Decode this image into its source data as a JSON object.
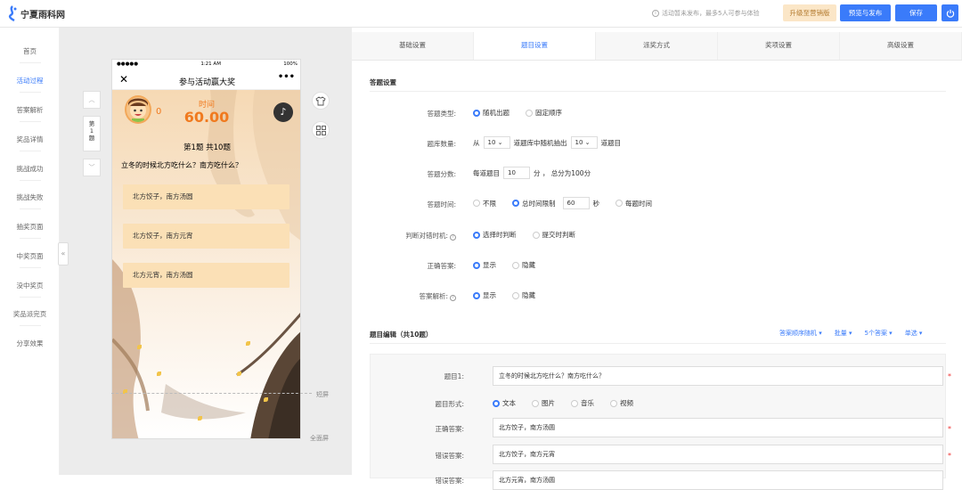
{
  "header": {
    "logo_text": "宁夏雨科网",
    "notice": "活动暂未发布，最多5人可参与体验",
    "upgrade_label": "升级至营销版",
    "preview_label": "预览与发布",
    "save_label": "保存"
  },
  "sidebar": {
    "items": [
      {
        "label": "首页",
        "active": false
      },
      {
        "label": "活动过程",
        "active": true
      },
      {
        "label": "答案解析",
        "active": false
      },
      {
        "label": "奖品详情",
        "active": false
      },
      {
        "label": "挑战成功",
        "active": false
      },
      {
        "label": "挑战失败",
        "active": false
      },
      {
        "label": "抽奖页面",
        "active": false
      },
      {
        "label": "中奖页面",
        "active": false
      },
      {
        "label": "没中奖页",
        "active": false
      },
      {
        "label": "奖品派完页",
        "active": false
      },
      {
        "label": "分享效果",
        "active": false
      }
    ],
    "collapse_glyph": "«"
  },
  "pagenav": {
    "up_glyph": "︿",
    "current": [
      "第",
      "1",
      "题"
    ],
    "down_glyph": "﹀"
  },
  "phone": {
    "status_left": "●●●●●",
    "status_time": "1:21 AM",
    "status_right": "100%",
    "close_glyph": "✕",
    "title": "参与活动赢大奖",
    "more_glyph": "•••",
    "score": "0",
    "timer_label": "时间",
    "timer_value": "60.00",
    "music_glyph": "♪",
    "question_number": "第1题 共10题",
    "question_text": "立冬的时候北方吃什么？南方吃什么？",
    "options": [
      "北方饺子，南方汤圆",
      "北方饺子，南方元宵",
      "北方元宵，南方汤圆"
    ]
  },
  "canvas": {
    "short_screen_label": "短屏",
    "full_screen_label": "全面屏",
    "tool_icons": [
      "shirt-icon",
      "qrcode-icon"
    ]
  },
  "tabs": [
    {
      "label": "基础设置",
      "active": false
    },
    {
      "label": "题目设置",
      "active": true
    },
    {
      "label": "派奖方式",
      "active": false
    },
    {
      "label": "奖项设置",
      "active": false
    },
    {
      "label": "高级设置",
      "active": false
    }
  ],
  "answer_settings": {
    "title": "答题设置",
    "type_label": "答题类型:",
    "type_options": [
      "随机出题",
      "固定顺序"
    ],
    "count_label": "题库数量:",
    "count_from": "从",
    "count_total": "10",
    "count_mid": "道题库中随机抽出",
    "count_pick": "10",
    "count_unit": "道题目",
    "score_label": "答题分数:",
    "score_prefix": "每道题目",
    "score_value": "10",
    "score_suffix": "分 ， 总分为100分",
    "time_label": "答题时间:",
    "time_opt_none": "不限",
    "time_opt_total": "总时间限制",
    "time_value": "60",
    "time_unit": "秒",
    "time_opt_each": "每题时间",
    "judge_label": "判断对错时机:",
    "judge_options": [
      "选择时判断",
      "提交时判断"
    ],
    "correct_label": "正确答案:",
    "correct_options": [
      "显示",
      "隐藏"
    ],
    "analysis_label": "答案解析:",
    "analysis_options": [
      "显示",
      "隐藏"
    ]
  },
  "question_edit": {
    "title": "题目编辑（共10题）",
    "links": [
      "答案顺序随机 ▾",
      "批量 ▾",
      "5个答案 ▾",
      "单选 ▾"
    ],
    "q_label": "题目1:",
    "q_value": "立冬的时候北方吃什么？南方吃什么？",
    "form_label": "题目形式:",
    "form_options": [
      "文本",
      "图片",
      "音乐",
      "视频"
    ],
    "correct_label": "正确答案:",
    "correct_value": "北方饺子，南方汤圆",
    "wrong_label": "错误答案:",
    "wrong_value": "北方饺子，南方元宵",
    "wrong2_label": "错误答案:",
    "wrong2_value": "北方元宵，南方汤圆",
    "required_mark": "*"
  },
  "colors": {
    "accent": "#3a7bfa",
    "orange": "#f07a1f",
    "option_bg": "#fbe0b6"
  }
}
